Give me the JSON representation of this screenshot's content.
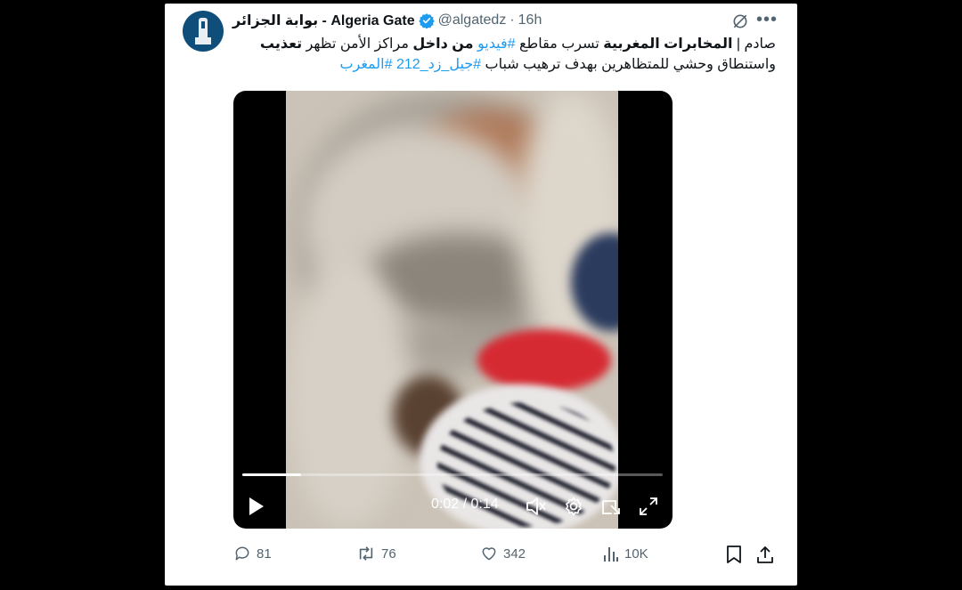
{
  "tweet": {
    "author_name": "بوابة الجزائر - Algeria Gate",
    "handle": "@algatedz",
    "separator": "·",
    "time_ago": "16h",
    "line1_plain_a": "صادم | ",
    "line1_bold_a": "المخابرات المغربية",
    "line1_plain_b": " تسرب مقاطع ",
    "line1_hashtag": "#فيديو",
    "line1_bold_b": " من داخل",
    "line1_plain_c": " مراكز الأمن تظهر ",
    "line1_bold_c": "تعذيب",
    "line2_plain": " واستنطاق وحشي للمتظاهرين بهدف ترهيب شباب ",
    "line2_hashtag1": "#جيل_زد_212",
    "line2_hashtag2": "#المغرب"
  },
  "video": {
    "current_time": "0:02",
    "time_separator": " / ",
    "duration": "0:14",
    "progress": 0.14
  },
  "actions": {
    "replies": "81",
    "reposts": "76",
    "likes": "342",
    "views": "10K"
  },
  "colors": {
    "accent": "#1d9bf0",
    "muted": "#536471",
    "text": "#0f1419"
  }
}
